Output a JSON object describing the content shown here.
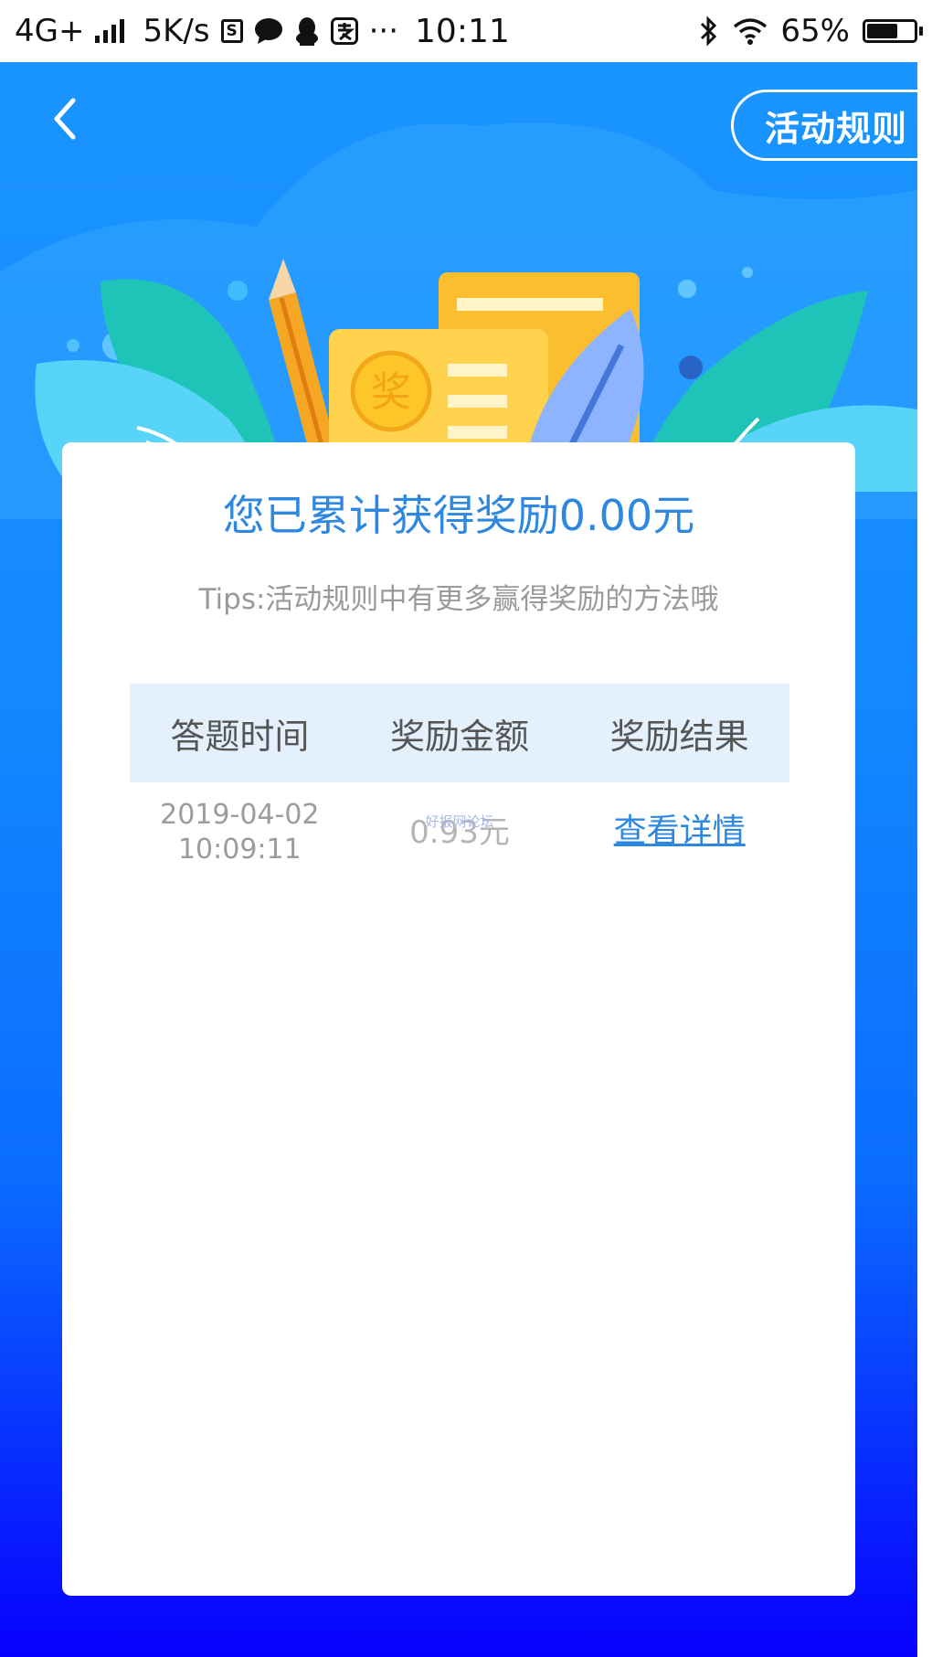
{
  "status_bar": {
    "network": "4G+",
    "speed": "5K/s",
    "s_icon": "S",
    "more": "···",
    "time": "10:11",
    "battery": "65%",
    "battery_level": 0.65,
    "icons": [
      "signal-icon",
      "s-icon",
      "chat-icon",
      "qq-icon",
      "app-icon",
      "bluetooth-icon",
      "wifi-icon",
      "battery-icon"
    ]
  },
  "header": {
    "back_icon": "chevron-left-icon",
    "rules_label": "活动规则"
  },
  "illustration": {
    "badge_char": "奖"
  },
  "summary": {
    "title": "您已累计获得奖励0.00元",
    "tips": "Tips:活动规则中有更多赢得奖励的方法哦"
  },
  "table": {
    "headers": [
      "答题时间",
      "奖励金额",
      "奖励结果"
    ],
    "rows": [
      {
        "date": "2019-04-02",
        "time": "10:09:11",
        "amount": "0.93元",
        "result": "查看详情"
      }
    ]
  },
  "watermark": "好报网论坛",
  "colors": {
    "primary_blue": "#2f88e0",
    "bg_top": "#1a95ff",
    "bg_bottom": "#0700ff",
    "header_row": "#e4f1fd"
  }
}
